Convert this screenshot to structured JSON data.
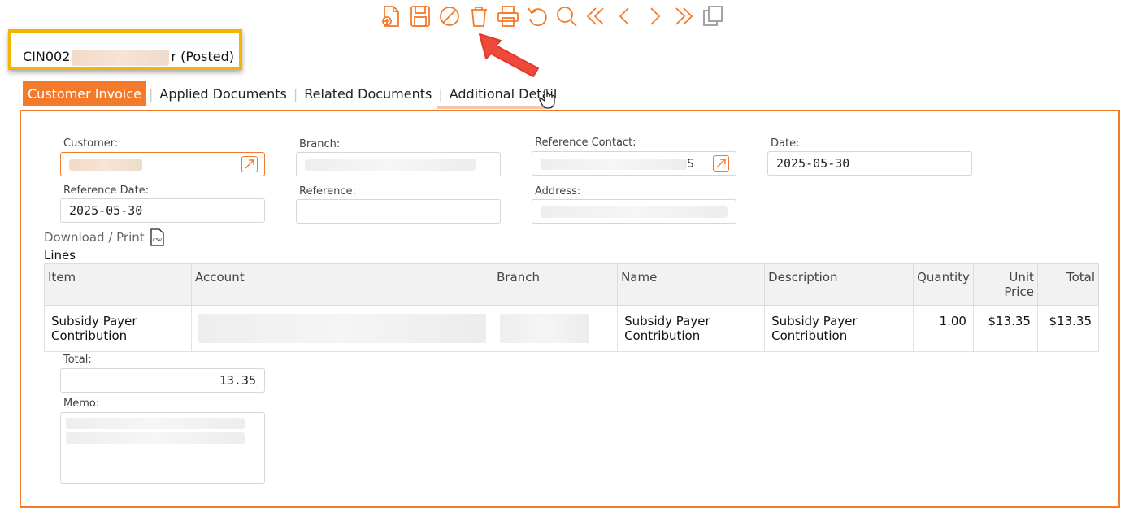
{
  "toolbar": {
    "buttons": [
      {
        "name": "new-document-icon"
      },
      {
        "name": "save-icon"
      },
      {
        "name": "void-icon"
      },
      {
        "name": "delete-icon"
      },
      {
        "name": "print-icon"
      },
      {
        "name": "undo-icon"
      },
      {
        "name": "search-icon"
      },
      {
        "name": "first-record-icon"
      },
      {
        "name": "previous-record-icon"
      },
      {
        "name": "next-record-icon"
      },
      {
        "name": "last-record-icon"
      },
      {
        "name": "copy-icon"
      }
    ],
    "accent_color": "#f47a2b",
    "disabled_color": "#9a9a9a"
  },
  "document": {
    "title_prefix": "CIN002",
    "title_suffix": "r (Posted)",
    "highlight_color": "#f5b400"
  },
  "tabs": [
    {
      "label": "Customer Invoice",
      "active": true
    },
    {
      "label": "Applied Documents",
      "active": false
    },
    {
      "label": "Related Documents",
      "active": false
    },
    {
      "label": "Additional Details",
      "active": false
    }
  ],
  "form": {
    "customer_label": "Customer:",
    "branch_label": "Branch:",
    "reference_contact_label": "Reference Contact:",
    "reference_contact_visible_suffix": "S",
    "date_label": "Date:",
    "date_value": "2025-05-30",
    "reference_date_label": "Reference Date:",
    "reference_date_value": "2025-05-30",
    "reference_label": "Reference:",
    "reference_value": "",
    "address_label": "Address:"
  },
  "download_print_label": "Download / Print",
  "csv_icon_label": "CSV",
  "lines": {
    "title": "Lines",
    "columns": [
      "Item",
      "Account",
      "Branch",
      "Name",
      "Description",
      "Quantity",
      "Unit Price",
      "Total"
    ],
    "rows": [
      {
        "item": "Subsidy Payer Contribution",
        "account": "",
        "branch": "",
        "name": "Subsidy Payer Contribution",
        "description": "Subsidy Payer Contribution",
        "quantity": "1.00",
        "unit_price": "$13.35",
        "total": "$13.35"
      }
    ]
  },
  "total_label": "Total:",
  "total_value": "13.35",
  "memo_label": "Memo:"
}
